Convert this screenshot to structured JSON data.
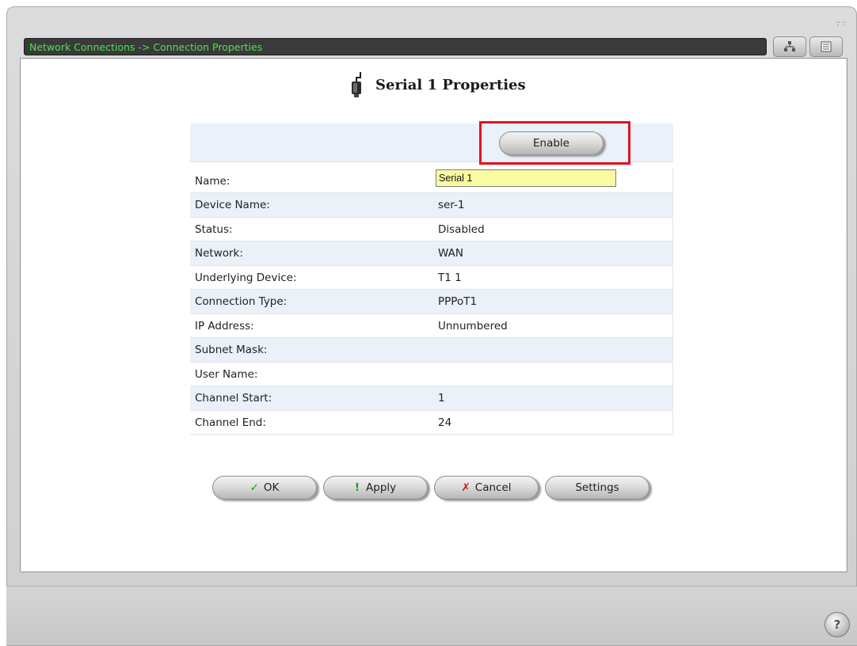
{
  "breadcrumb": "Network Connections -> Connection Properties",
  "title": "Serial 1 Properties",
  "enable_button": "Enable",
  "name_field": {
    "label": "Name:",
    "value": "Serial 1"
  },
  "rows": [
    {
      "label": "Device Name:",
      "value": "ser-1"
    },
    {
      "label": "Status:",
      "value": "Disabled"
    },
    {
      "label": "Network:",
      "value": "WAN"
    },
    {
      "label": "Underlying Device:",
      "value": "T1 1"
    },
    {
      "label": "Connection Type:",
      "value": "PPPoT1"
    },
    {
      "label": "IP Address:",
      "value": "Unnumbered"
    },
    {
      "label": "Subnet Mask:",
      "value": ""
    },
    {
      "label": "User Name:",
      "value": ""
    },
    {
      "label": "Channel Start:",
      "value": "1"
    },
    {
      "label": "Channel End:",
      "value": "24"
    }
  ],
  "actions": {
    "ok": "OK",
    "apply": "Apply",
    "cancel": "Cancel",
    "settings": "Settings"
  },
  "help": "?",
  "icons": {
    "title": "serial-cable-icon",
    "ok": "check-icon",
    "apply": "exclamation-icon",
    "cancel": "x-icon",
    "view1": "network-map-icon",
    "view2": "list-view-icon",
    "help": "help-icon"
  },
  "colors": {
    "breadcrumb_text": "#4fe04f",
    "highlight": "#e0141e",
    "input_bg": "#fafaa0",
    "row_alt": "#eaf1f9"
  }
}
